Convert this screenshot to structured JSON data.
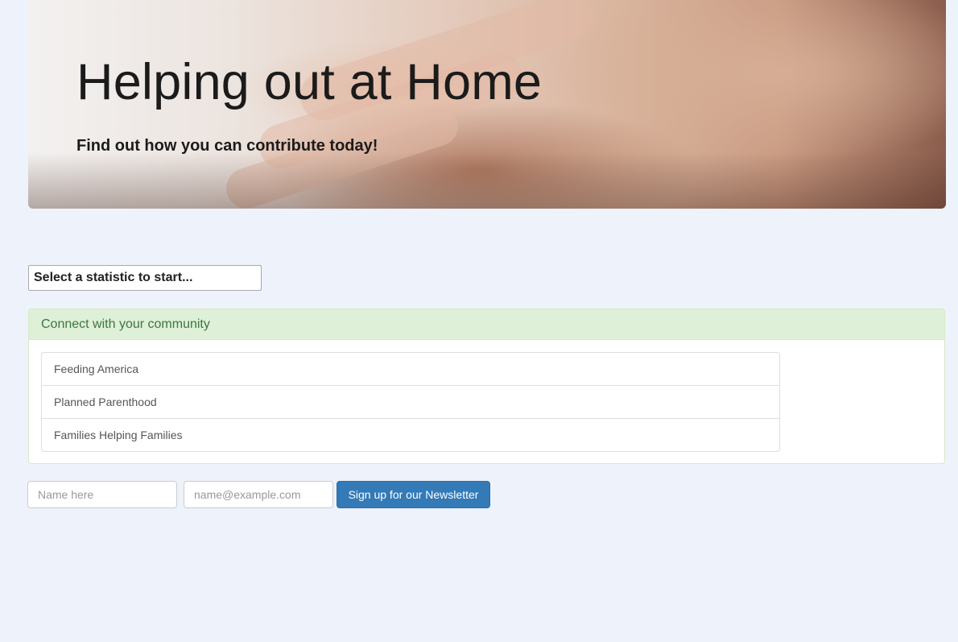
{
  "hero": {
    "title": "Helping out at Home",
    "subtitle": "Find out how you can contribute today!"
  },
  "statistic_select": {
    "selected": "Select a statistic to start..."
  },
  "community_panel": {
    "heading": "Connect with your community",
    "items": [
      {
        "label": "Feeding America"
      },
      {
        "label": "Planned Parenthood"
      },
      {
        "label": "Families Helping Families"
      }
    ]
  },
  "newsletter": {
    "name_placeholder": "Name here",
    "email_placeholder": "name@example.com",
    "button_label": "Sign up for our Newsletter"
  },
  "colors": {
    "page_bg": "#eef2fa",
    "panel_heading_bg": "#dff0d8",
    "panel_heading_text": "#3c763d",
    "button_bg": "#337ab7"
  }
}
